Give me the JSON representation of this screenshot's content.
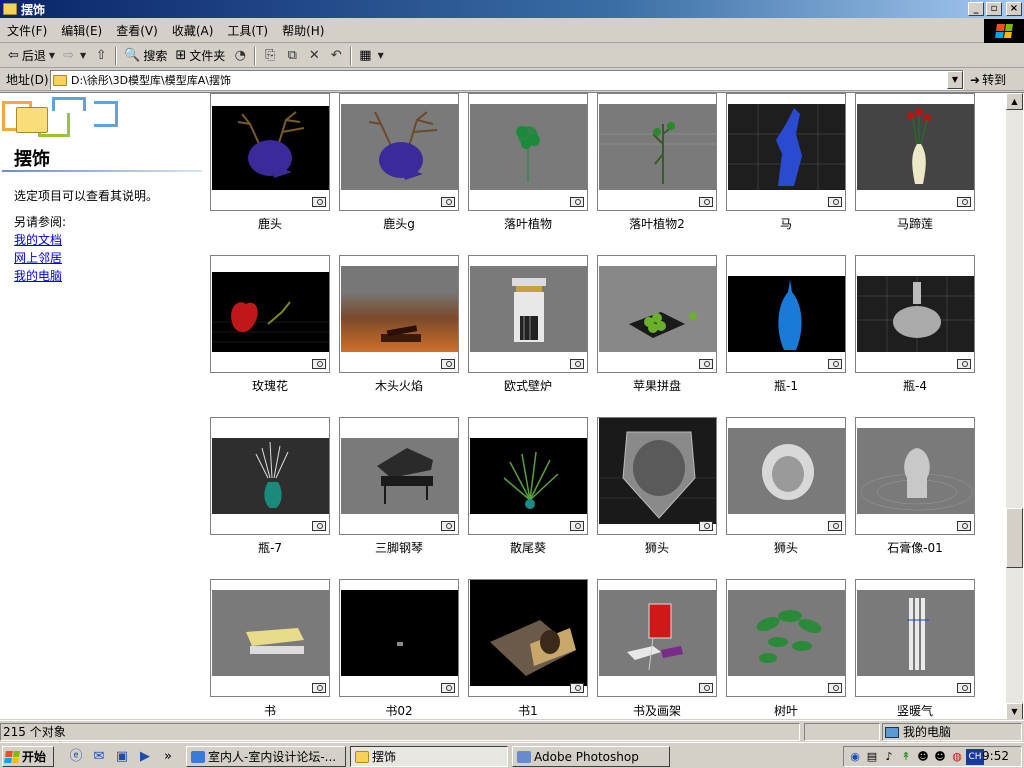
{
  "window": {
    "title": "摆饰"
  },
  "menu": [
    "文件(F)",
    "编辑(E)",
    "查看(V)",
    "收藏(A)",
    "工具(T)",
    "帮助(H)"
  ],
  "toolbar": {
    "back": "后退",
    "search": "搜索",
    "folders": "文件夹"
  },
  "address": {
    "label": "地址(D)",
    "path": "D:\\徐彤\\3D模型库\\模型库A\\摆饰",
    "go": "转到"
  },
  "left_pane": {
    "title": "摆饰",
    "description": "选定项目可以查看其说明。",
    "see_also": "另请参阅:",
    "links": [
      "我的文档",
      "网上邻居",
      "我的电脑"
    ]
  },
  "items": [
    "鹿头",
    "鹿头g",
    "落叶植物",
    "落叶植物2",
    "马",
    "马蹄莲",
    "玫瑰花",
    "木头火焰",
    "欧式壁炉",
    "苹果拼盘",
    "瓶-1",
    "瓶-4",
    "瓶-7",
    "三脚钢琴",
    "散尾葵",
    "狮头",
    "狮头",
    "石膏像-01",
    "书",
    "书02",
    "书1",
    "书及画架",
    "树叶",
    "竖暖气"
  ],
  "status": {
    "count": "215 个对象",
    "location": "我的电脑"
  },
  "taskbar": {
    "start": "开始",
    "tasks": [
      "室内人-室内设计论坛-...",
      "摆饰",
      "Adobe Photoshop"
    ],
    "tray_lang": "CH",
    "time": "9:52"
  }
}
